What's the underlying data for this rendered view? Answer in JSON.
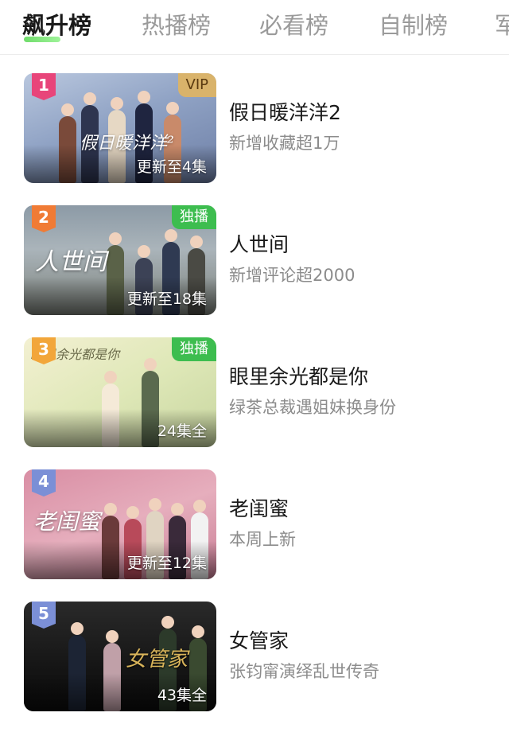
{
  "tabs": [
    {
      "label": "飙升榜"
    },
    {
      "label": "热播榜"
    },
    {
      "label": "必看榜"
    },
    {
      "label": "自制榜"
    },
    {
      "label": "军"
    }
  ],
  "colors": {
    "active_tab_accent": "#6fdc6a",
    "vip_badge": "#d9b36b",
    "exclusive_badge": "#3dbd4f",
    "rank_1": "#e8457a",
    "rank_2": "#f07b35",
    "rank_3": "#f2a63a",
    "rank_4": "#7b8fd6",
    "rank_5": "#7b8fd6"
  },
  "items": [
    {
      "rank": "1",
      "badge": "VIP",
      "poster_text": "假日暖洋洋²",
      "episodes": "更新至4集",
      "title": "假日暖洋洋2",
      "desc": "新增收藏超1万"
    },
    {
      "rank": "2",
      "badge": "独播",
      "poster_text": "人世间",
      "episodes": "更新至18集",
      "title": "人世间",
      "desc": "新增评论超2000"
    },
    {
      "rank": "3",
      "badge": "独播",
      "poster_text": "眼里余光都是你",
      "episodes": "24集全",
      "title": "眼里余光都是你",
      "desc": "绿茶总裁遇姐妹换身份"
    },
    {
      "rank": "4",
      "badge": "",
      "poster_text": "老闺蜜",
      "episodes": "更新至12集",
      "title": "老闺蜜",
      "desc": "本周上新"
    },
    {
      "rank": "5",
      "badge": "",
      "poster_text": "女管家",
      "episodes": "43集全",
      "title": "女管家",
      "desc": "张钧甯演绎乱世传奇"
    }
  ]
}
